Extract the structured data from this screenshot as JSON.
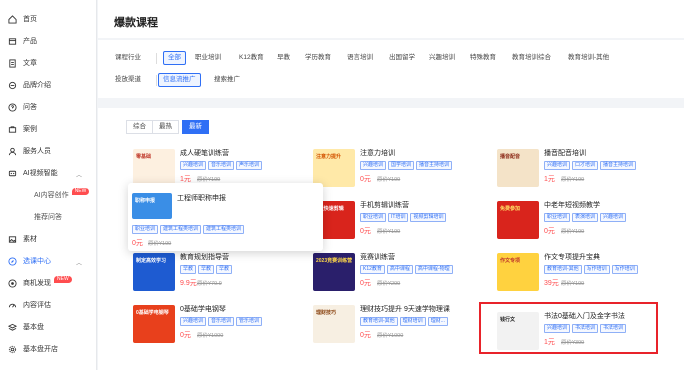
{
  "sidebar": {
    "items": [
      {
        "label": "首页",
        "icon": "home-icon"
      },
      {
        "label": "产品",
        "icon": "box-icon"
      },
      {
        "label": "文章",
        "icon": "document-icon"
      },
      {
        "label": "品牌介绍",
        "icon": "brand-icon"
      },
      {
        "label": "问答",
        "icon": "question-icon"
      },
      {
        "label": "案例",
        "icon": "case-icon"
      },
      {
        "label": "服务人员",
        "icon": "user-icon"
      },
      {
        "label": "AI视频智能",
        "icon": "ai-icon",
        "expanded": true
      },
      {
        "label": "AI内容创作",
        "sub": true,
        "badge": "NEW"
      },
      {
        "label": "推荐问答",
        "sub": true
      },
      {
        "label": "素材",
        "icon": "image-icon"
      },
      {
        "label": "选课中心",
        "icon": "compass-icon",
        "active": true,
        "expanded": true
      },
      {
        "label": "商机发现",
        "icon": "opportunity-icon",
        "badge": "NEW"
      },
      {
        "label": "内容评估",
        "icon": "gauge-icon"
      },
      {
        "label": "基本盘",
        "icon": "layers-icon"
      },
      {
        "label": "基本盘开店",
        "icon": "gear-icon"
      }
    ]
  },
  "header": {
    "title": "爆款课程"
  },
  "filters": {
    "row1": [
      "课程行业",
      "全部",
      "职业培训",
      "K12教育",
      "早教",
      "学历教育",
      "语言培训",
      "出国留学",
      "兴趣培训",
      "特殊教育",
      "教育培训综合",
      "教育培训-其他"
    ],
    "row1_selected": 1,
    "row2_label": "投放渠道",
    "row2": [
      "信息流推广",
      "搜索推广"
    ],
    "row2_selected": 0
  },
  "sort": {
    "tabs": [
      "综合",
      "最热",
      "最新"
    ],
    "selected": 2
  },
  "cards": [
    {
      "title": "成人硬笔训练营",
      "tags": [
        "兴趣培训",
        "音乐培训",
        "声乐培训"
      ],
      "price": "1元",
      "orig": "原价¥199",
      "thumb": "#fdf0e0",
      "thumb_text": "零基础",
      "thumb_color": "#c0392b"
    },
    {
      "title": "注意力培训",
      "tags": [
        "兴趣培训",
        "国学培训",
        "播音主持培训"
      ],
      "price": "0元",
      "orig": "原价¥199",
      "thumb": "#ffe9a8",
      "thumb_text": "注意力提升",
      "thumb_color": "#d35400"
    },
    {
      "title": "播音配音培训",
      "tags": [
        "兴趣培训",
        "口才培训",
        "播音主持培训"
      ],
      "price": "1元",
      "orig": "原价¥199",
      "thumb": "#f4e3c8",
      "thumb_text": "播音配音",
      "thumb_color": "#8e2d1b"
    },
    {
      "title": "手机剪辑训练营",
      "tags": [
        "职业培训",
        "IT培训",
        "视频剪辑培训"
      ],
      "price": "0元",
      "orig": "原价¥199",
      "thumb": "#d9241c",
      "thumb_text": "5天快速剪辑",
      "thumb_color": "#ffffff"
    },
    {
      "title": "中老年短视频教学",
      "tags": [
        "职业培训",
        "表演培训",
        "兴趣培训"
      ],
      "price": "0元",
      "orig": "原价¥199",
      "thumb": "#d9241c",
      "thumb_text": "免费参加",
      "thumb_color": "#ffe066"
    },
    {
      "title": "教育规划指导营",
      "tags": [
        "早教",
        "早教",
        "早教"
      ],
      "price": "9.9元",
      "orig": "原价¥79.9",
      "thumb": "#1e5bd1",
      "thumb_text": "制定高效学习",
      "thumb_color": "#ffffff"
    },
    {
      "title": "竞赛训练营",
      "tags": [
        "K12教育",
        "高中课程",
        "高中课程-物理"
      ],
      "price": "0元",
      "orig": "原价¥299",
      "thumb": "#2a1f6b",
      "thumb_text": "2023竞赛训练营",
      "thumb_color": "#ffd84a"
    },
    {
      "title": "作文专项提升宝典",
      "tags": [
        "教育培训-其他",
        "写作培训",
        "写作培训"
      ],
      "price": "39元",
      "orig": "原价¥199",
      "thumb": "#ffd23f",
      "thumb_text": "作文专项",
      "thumb_color": "#c0392b"
    },
    {
      "title": "0基础学电钢琴",
      "tags": [
        "兴趣培训",
        "音乐培训",
        "管乐培训"
      ],
      "price": "0元",
      "orig": "原价¥1000",
      "thumb": "#e8401c",
      "thumb_text": "0基础学电钢琴",
      "thumb_color": "#ffffff"
    },
    {
      "title": "理财技巧提升 9天速学物理课",
      "tags": [
        "教育培训-其他",
        "理财培训",
        "理财..."
      ],
      "price": "0元",
      "orig": "原价¥1000",
      "thumb": "#f7efe2",
      "thumb_text": "理财技巧",
      "thumb_color": "#8b4513"
    },
    {
      "title": "书法0基础入门及金字书法",
      "tags": [
        "兴趣培训",
        "书法培训",
        "书法培训"
      ],
      "price": "1元",
      "orig": "原价¥399",
      "thumb": "#f2f2f2",
      "thumb_text": "钱行文",
      "thumb_color": "#222222"
    }
  ],
  "popup": {
    "title": "工程师职称申报",
    "tags": [
      "职业培训",
      "建筑工程类培训",
      "建筑工程类培训"
    ],
    "price": "0元",
    "orig": "原价¥199",
    "thumb_text": "职称申报",
    "thumb": "#3a8ee6"
  }
}
